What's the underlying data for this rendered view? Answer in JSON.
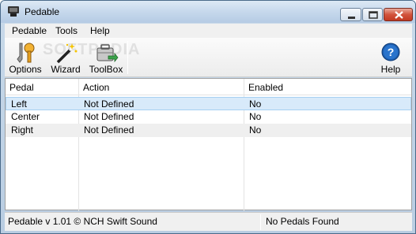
{
  "window": {
    "title": "Pedable"
  },
  "menu": [
    "Pedable",
    "Tools",
    "Help"
  ],
  "toolbar": {
    "buttons": [
      {
        "label": "Options",
        "icon": "options-icon"
      },
      {
        "label": "Wizard",
        "icon": "wizard-icon"
      },
      {
        "label": "ToolBox",
        "icon": "toolbox-icon"
      },
      {
        "label": "Help",
        "icon": "help-icon"
      }
    ],
    "watermark": "SOFTPEDIA"
  },
  "table": {
    "columns": [
      "Pedal",
      "Action",
      "Enabled"
    ],
    "rows": [
      {
        "pedal": "Left",
        "action": "Not Defined",
        "enabled": "No"
      },
      {
        "pedal": "Center",
        "action": "Not Defined",
        "enabled": "No"
      },
      {
        "pedal": "Right",
        "action": "Not Defined",
        "enabled": "No"
      }
    ]
  },
  "status": {
    "left": "Pedable v 1.01 © NCH Swift Sound",
    "right": "No Pedals Found"
  },
  "colors": {
    "selection": "#d8eafa",
    "close_button": "#c13a22",
    "help_icon": "#1f5fb0"
  }
}
